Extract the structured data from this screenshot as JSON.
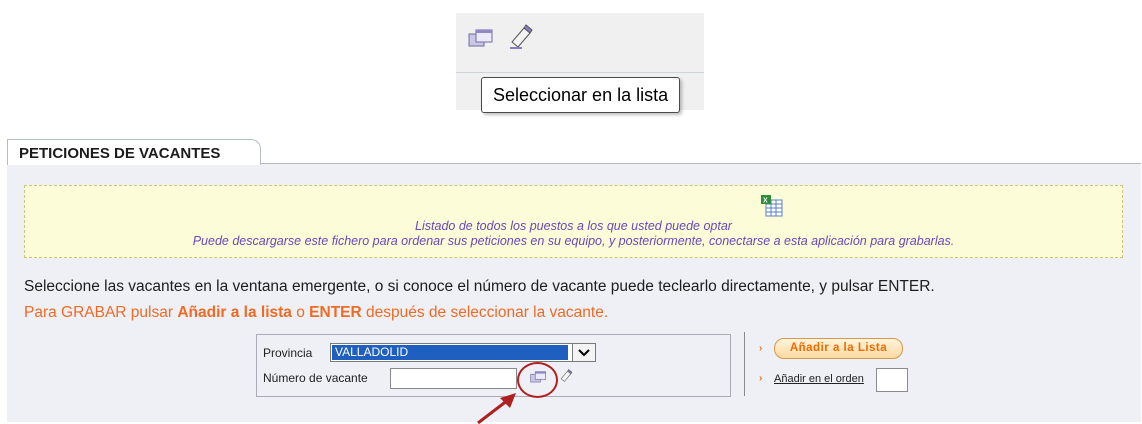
{
  "tooltip": {
    "text": "Seleccionar en la lista"
  },
  "tab": {
    "label": "PETICIONES DE VACANTES"
  },
  "notice": {
    "line1": "Listado de todos los puestos a los que usted puede optar",
    "line2": "Puede descargarse este fichero para ordenar sus peticiones en su equipo, y posteriormente, conectarse a esta aplicación para grabarlas."
  },
  "instructions": {
    "line1": "Seleccione las vacantes en la ventana emergente, o si conoce el número de vacante puede teclearlo directamente, y pulsar ENTER.",
    "line2_parts": [
      "Para GRABAR pulsar ",
      "Añadir a la lista",
      " o ",
      "ENTER",
      " después de seleccionar la vacante."
    ]
  },
  "form": {
    "provincia_label": "Provincia",
    "provincia_value": "VALLADOLID",
    "numero_label": "Número de vacante",
    "numero_value": ""
  },
  "actions": {
    "add_button": "Añadir a la Lista",
    "order_link": "Añadir en el orden",
    "order_value": ""
  },
  "icons": [
    "select-list-icon",
    "eraser-icon",
    "excel-icon",
    "chevron-right-icon",
    "dropdown-arrow-icon"
  ],
  "colors": {
    "accent_orange": "#f06a24",
    "notice_text": "#6a48b8",
    "selection_blue": "#1f5fbf",
    "highlight_red": "#b02020"
  }
}
